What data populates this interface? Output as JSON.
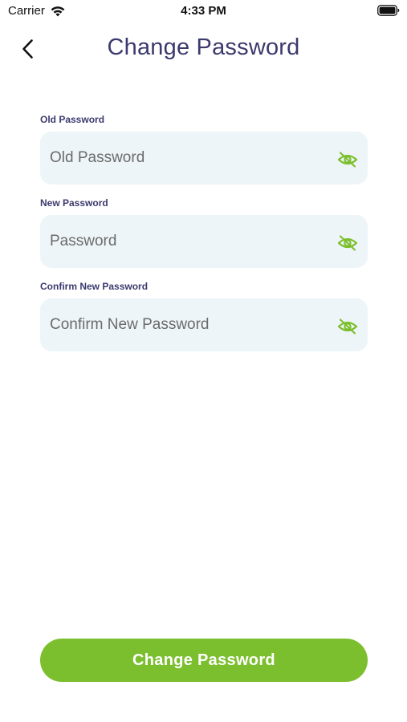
{
  "status_bar": {
    "carrier": "Carrier",
    "time": "4:33 PM"
  },
  "header": {
    "title": "Change Password",
    "back_icon": "chevron-left-icon"
  },
  "form": {
    "fields": [
      {
        "label": "Old Password",
        "placeholder": "Old Password",
        "value": "",
        "toggle_icon": "eye-off-icon"
      },
      {
        "label": "New Password",
        "placeholder": "Password",
        "value": "",
        "toggle_icon": "eye-off-icon"
      },
      {
        "label": "Confirm New Password",
        "placeholder": "Confirm New Password",
        "value": "",
        "toggle_icon": "eye-off-icon"
      }
    ]
  },
  "submit": {
    "label": "Change Password"
  },
  "colors": {
    "title": "#3b3a6e",
    "accent_green": "#7cbf2e",
    "field_background": "#eef5f8"
  }
}
